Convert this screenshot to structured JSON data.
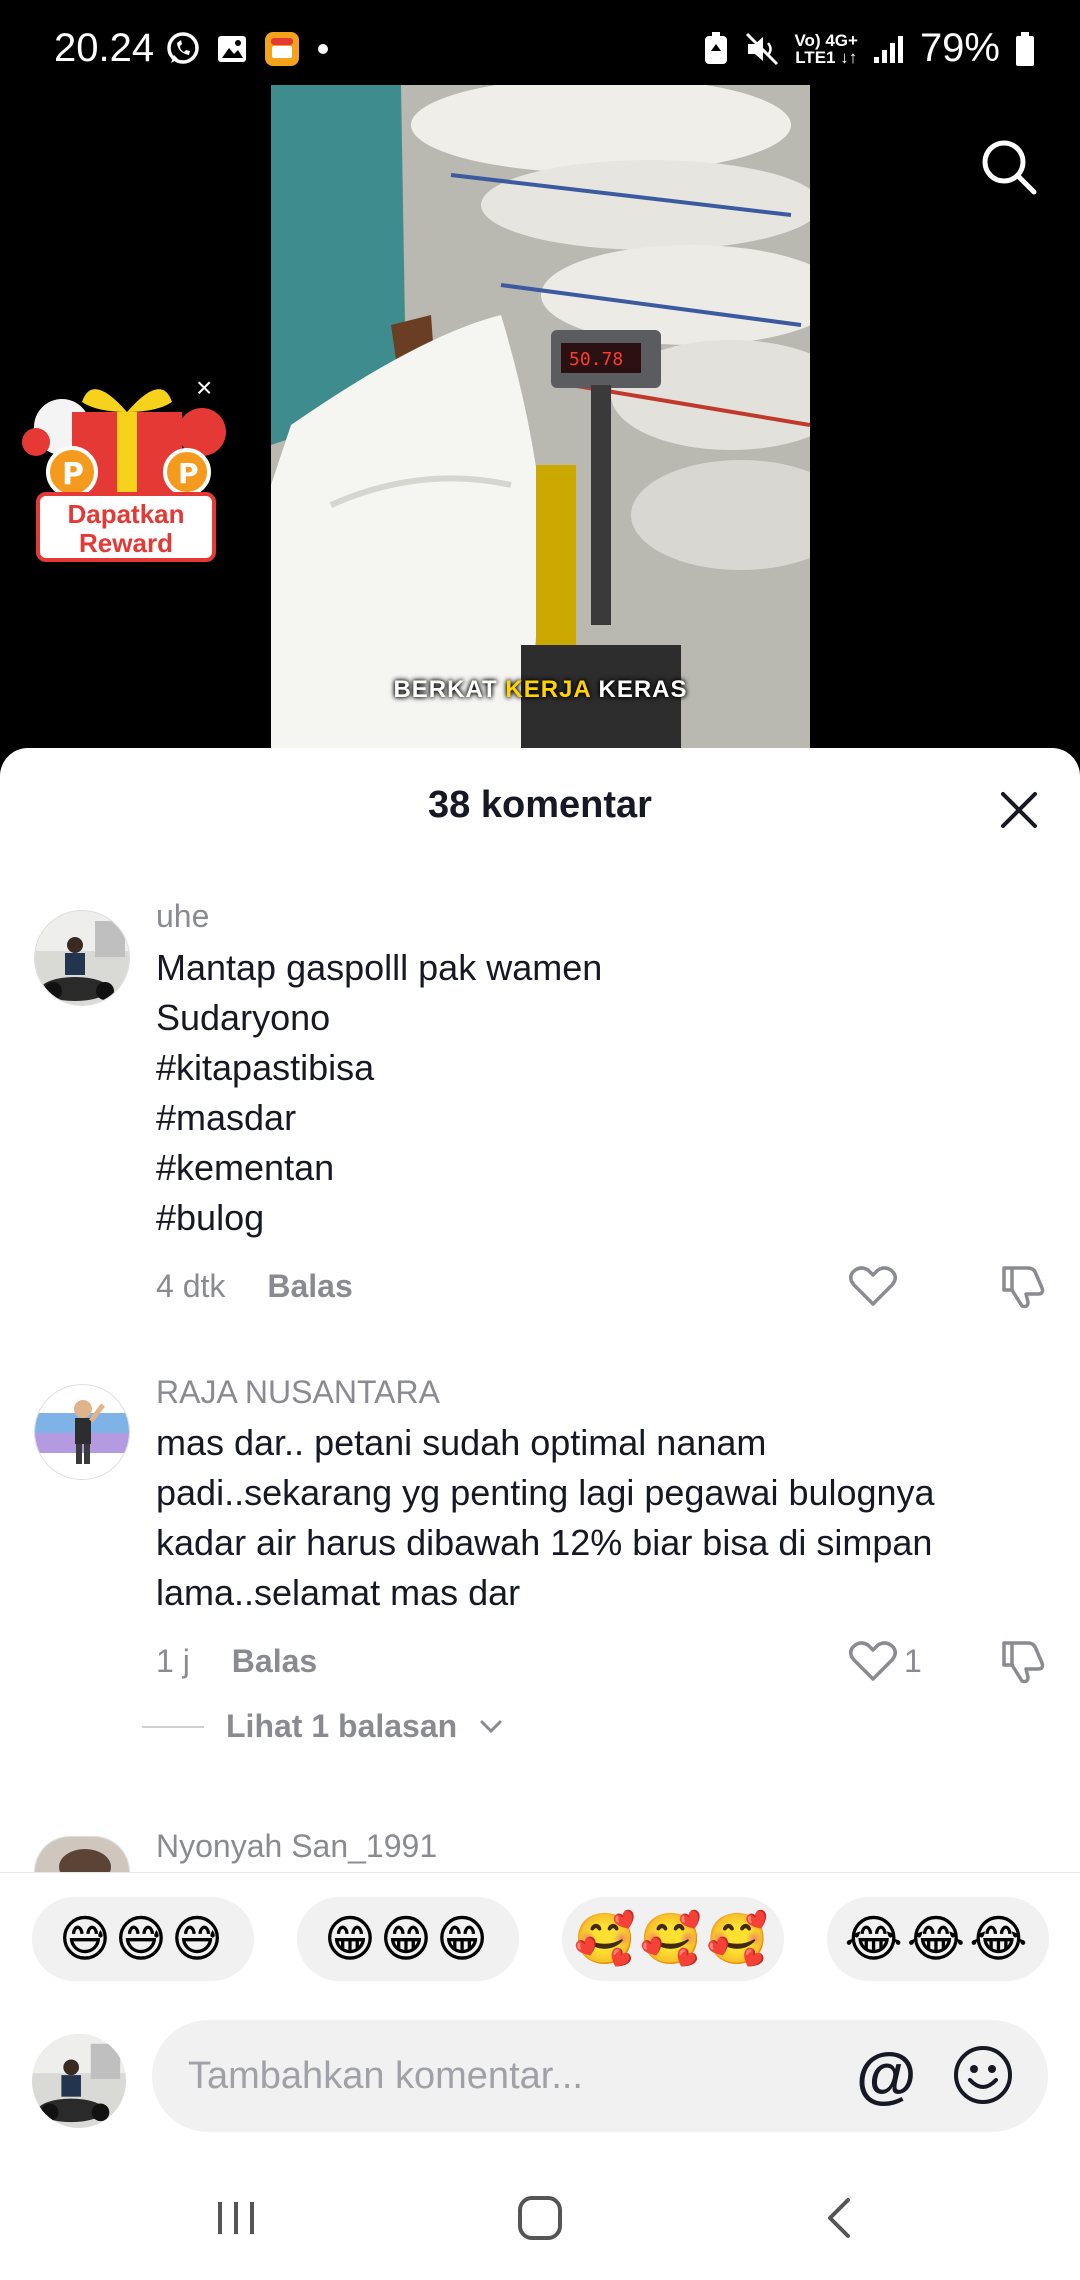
{
  "status_bar": {
    "time": "20.24",
    "battery": "79%",
    "network_top": "Vo) 4G+",
    "network_bottom": "LTE1 ↓↑"
  },
  "video": {
    "caption_part1": "BERKAT",
    "caption_highlight": "KERJA",
    "caption_part2": "KERAS",
    "reward_label_line1": "Dapatkan",
    "reward_label_line2": "Reward",
    "reward_close": "×"
  },
  "comments_panel": {
    "title": "38 komentar",
    "comments": [
      {
        "user": "uhe",
        "text": "Mantap gaspolll pak wamen\nSudaryono\n#kitapastibisa\n#masdar\n#kementan\n#bulog",
        "time": "4 dtk",
        "reply_label": "Balas",
        "likes": ""
      },
      {
        "user": "RAJA NUSANTARA",
        "text": "mas dar.. petani sudah optimal nanam\npadi..sekarang yg penting lagi pegawai bulognya\nkadar air harus dibawah 12% biar bisa di simpan\nlama..selamat mas dar",
        "time": "1 j",
        "reply_label": "Balas",
        "likes": "1"
      },
      {
        "user": "Nyonyah San_1991"
      }
    ],
    "view_replies": "Lihat 1 balasan"
  },
  "emoji_bar": {
    "items": [
      "😅😅😅",
      "😁😁😁",
      "🥰🥰🥰",
      "😂😂😂"
    ]
  },
  "input": {
    "placeholder": "Tambahkan komentar...",
    "at_symbol": "@"
  }
}
